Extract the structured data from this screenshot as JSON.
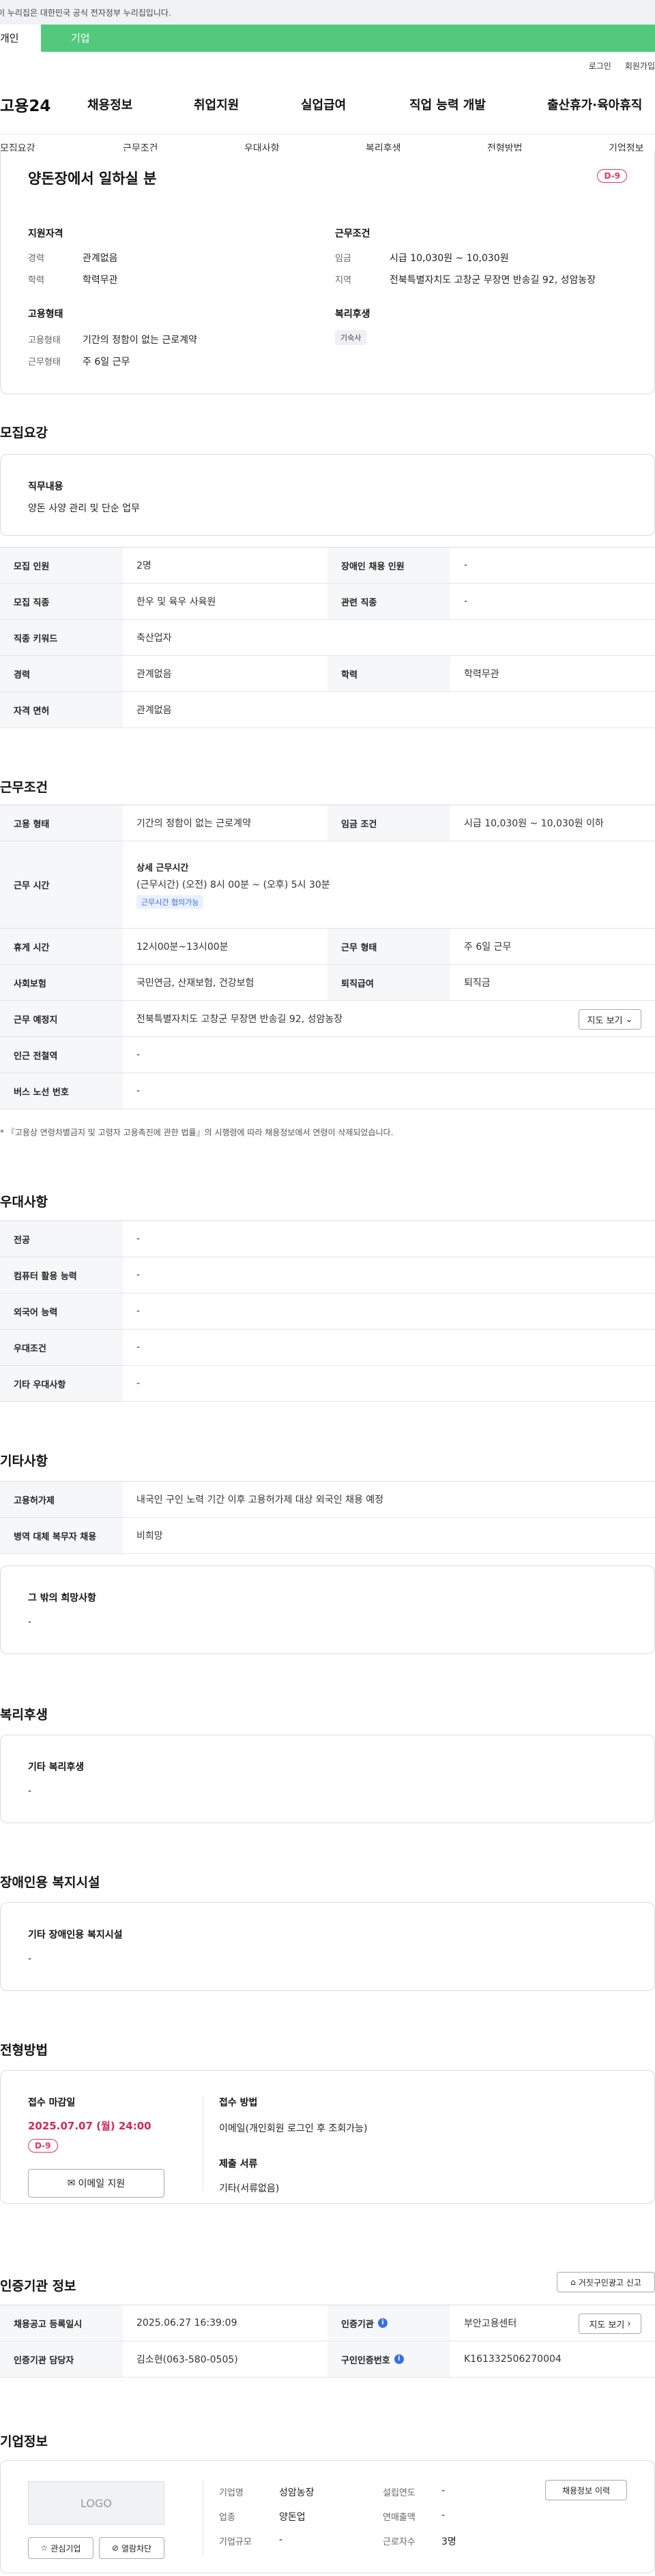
{
  "gov_banner": "이 누리집은 대한민국 공식 전자정부 누리집입니다.",
  "user_tabs": {
    "personal": "개인",
    "company": "기업"
  },
  "top_links": {
    "login": "로그인",
    "join": "회원가입"
  },
  "logo": "고용24",
  "gnb": [
    "채용정보",
    "취업지원",
    "실업급여",
    "직업 능력 개발",
    "출산휴가·육아휴직"
  ],
  "lnb": [
    "모집요강",
    "근무조건",
    "우대사항",
    "복리후생",
    "전형방법",
    "기업정보"
  ],
  "summary": {
    "title": "양돈장에서 일하실 분",
    "dday": "D-9",
    "qualification_title": "지원자격",
    "career_label": "경력",
    "career_value": "관계없음",
    "education_label": "학력",
    "education_value": "학력무관",
    "work_title": "근무조건",
    "wage_label": "임금",
    "wage_value": "시급 10,030원 ~ 10,030원",
    "region_label": "지역",
    "region_value": "전북특별자치도 고창군 무장면 반송길 92, 성암농장",
    "employment_title": "고용형태",
    "emp_type_label": "고용형태",
    "emp_type_value": "기간의 정함이 없는 근로계약",
    "work_form_label": "근무형태",
    "work_form_value": "주 6일 근무",
    "welfare_title": "복리후생",
    "welfare_tag": "기숙사"
  },
  "recruit": {
    "title": "모집요강",
    "job_desc_label": "직무내용",
    "job_desc_value": "양돈 사양 관리 및 단순 업무",
    "rows": {
      "headcount_label": "모집 인원",
      "headcount_value": "2명",
      "disabled_label": "장애인 채용 인원",
      "disabled_value": "-",
      "job_label": "모집 직종",
      "job_value": "한우 및 육우 사육원",
      "related_label": "관련 직종",
      "related_value": "-",
      "keyword_label": "직종 키워드",
      "keyword_value": "축산업자",
      "career_label": "경력",
      "career_value": "관계없음",
      "edu_label": "학력",
      "edu_value": "학력무관",
      "license_label": "자격 면허",
      "license_value": "관계없음"
    }
  },
  "conditions": {
    "title": "근무조건",
    "emp_type_label": "고용 형태",
    "emp_type_value": "기간의 정함이 없는 근로계약",
    "wage_label": "임금 조건",
    "wage_value": "시급 10,030원 ~ 10,030원 이하",
    "hours_label": "근무 시간",
    "hours_detail_title": "상세 근무시간",
    "hours_detail_value": "(근무시간) (오전) 8시 00분 ~ (오후) 5시 30분",
    "hours_tag": "근무시간 협의가능",
    "break_label": "휴게 시간",
    "break_value": "12시00분~13시00분",
    "form_label": "근무 형태",
    "form_value": "주 6일 근무",
    "insurance_label": "사회보험",
    "insurance_value": "국민연금, 산재보험, 건강보험",
    "severance_label": "퇴직급여",
    "severance_value": "퇴직금",
    "location_label": "근무 예정지",
    "location_value": "전북특별자치도 고창군 무장면 반송길 92, 성암농장",
    "map_button": "지도 보기",
    "subway_label": "인근 전철역",
    "subway_value": "-",
    "bus_label": "버스 노선 번호",
    "bus_value": "-",
    "note": "* 『고용상 연령차별금지 및 고령자 고용촉진에 관한 법률』의 시행령에 따라 채용정보에서 연령이 삭제되었습니다."
  },
  "preferences": {
    "title": "우대사항",
    "major_label": "전공",
    "major_value": "-",
    "computer_label": "컴퓨터 활용 능력",
    "computer_value": "-",
    "language_label": "외국어 능력",
    "language_value": "-",
    "pref_label": "우대조건",
    "pref_value": "-",
    "etc_label": "기타 우대사항",
    "etc_value": "-"
  },
  "others": {
    "title": "기타사항",
    "permit_label": "고용허가제",
    "permit_value": "내국인 구인 노력 기간 이후 고용허가제 대상 외국인 채용 예정",
    "military_label": "병역 대체 복무자 채용",
    "military_value": "비희망",
    "wish_title": "그 밖의 희망사항",
    "wish_value": "-"
  },
  "welfare": {
    "title": "복리후생",
    "etc_title": "기타 복리후생",
    "etc_value": "-"
  },
  "disabled_facility": {
    "title": "장애인용 복지시설",
    "etc_title": "기타 장애인용 복지시설",
    "etc_value": "-"
  },
  "selection": {
    "title": "전형방법",
    "deadline_label": "접수 마감일",
    "deadline_value": "2025.07.07 (월) 24:00",
    "dday": "D-9",
    "apply_button": "이메일 지원",
    "method_label": "접수 방법",
    "method_value": "이메일(개인회원 로그인 후 조회가능)",
    "docs_label": "제출 서류",
    "docs_value": "기타(서류없음)"
  },
  "agency": {
    "title": "인증기관 정보",
    "report_button": "거짓구인광고 신고",
    "reg_label": "채용공고 등록일시",
    "reg_value": "2025.06.27 16:39:09",
    "agency_label": "인증기관",
    "agency_value": "부안고용센터",
    "map_button": "지도 보기",
    "manager_label": "인증기관 담당자",
    "manager_value": "김소현(063-580-0505)",
    "cert_no_label": "구인인증번호",
    "cert_no_value": "K161332506270004"
  },
  "company": {
    "title": "기업정보",
    "logo_text": "LOGO",
    "interest_button": "관심기업",
    "block_button": "열람차단",
    "name_label": "기업명",
    "name_value": "성암농장",
    "industry_label": "업종",
    "industry_value": "양돈업",
    "size_label": "기업규모",
    "size_value": "-",
    "founded_label": "설립연도",
    "founded_value": "-",
    "revenue_label": "연매출액",
    "revenue_value": "-",
    "employees_label": "근로자수",
    "employees_value": "3명",
    "history_button": "채용정보 이력"
  }
}
